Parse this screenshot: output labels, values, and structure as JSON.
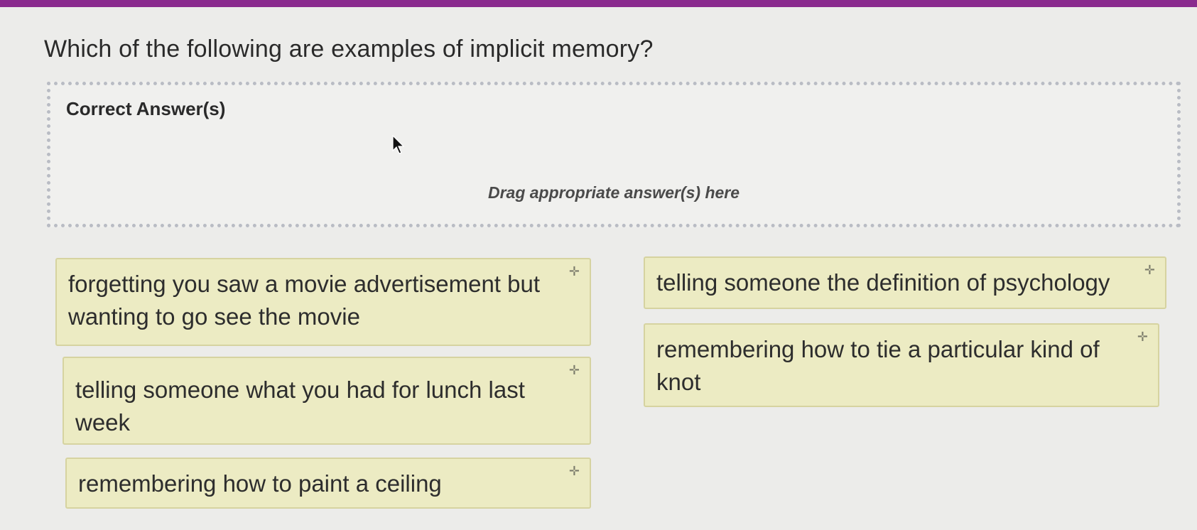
{
  "question": {
    "text": "Which of the following are examples of implicit memory?"
  },
  "drop_zone": {
    "title": "Correct Answer(s)",
    "hint": "Drag appropriate answer(s) here"
  },
  "answer_cards": [
    {
      "text": "forgetting you saw a movie advertisement but wanting to go see the movie",
      "icon": "move-icon"
    },
    {
      "text": "telling someone the definition of psychology",
      "icon": "move-icon"
    },
    {
      "text": "remembering how to tie a particular kind of knot",
      "icon": "move-icon"
    },
    {
      "text": "telling someone what you had for lunch last week",
      "icon": "move-icon"
    },
    {
      "text": "remembering how to paint a ceiling",
      "icon": "move-icon"
    }
  ],
  "colors": {
    "top_bar": "#8a2a8e",
    "card_background": "#ecebc3",
    "card_border": "#d6d3a0",
    "drop_zone_border": "#b9bcc4"
  }
}
